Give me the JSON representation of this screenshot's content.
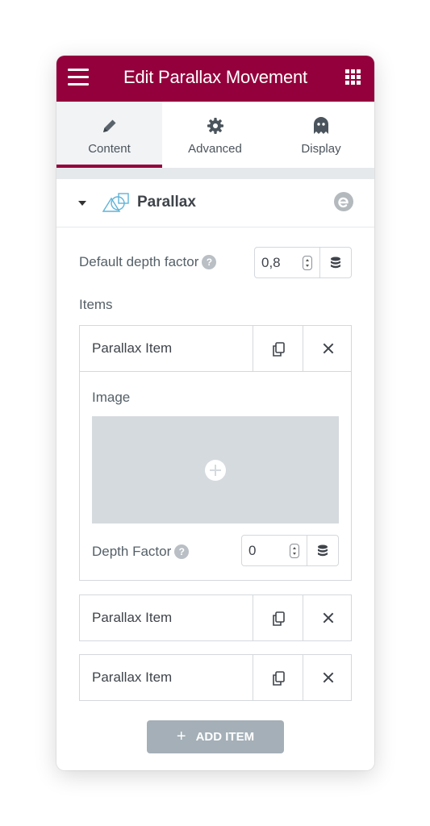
{
  "header": {
    "title": "Edit Parallax Movement"
  },
  "tabs": [
    {
      "label": "Content",
      "icon": "pencil-icon",
      "active": true
    },
    {
      "label": "Advanced",
      "icon": "gear-icon",
      "active": false
    },
    {
      "label": "Display",
      "icon": "ghost-icon",
      "active": false
    }
  ],
  "section": {
    "title": "Parallax",
    "icon": "parallax-shapes-icon",
    "badge_icon": "extension-logo-icon"
  },
  "default_depth": {
    "label": "Default depth factor",
    "value": "0,8"
  },
  "items_label": "Items",
  "items": [
    {
      "title": "Parallax Item",
      "expanded": true
    },
    {
      "title": "Parallax Item",
      "expanded": false
    },
    {
      "title": "Parallax Item",
      "expanded": false
    }
  ],
  "item_fields": {
    "image_label": "Image",
    "depth_label": "Depth Factor",
    "depth_value": "0"
  },
  "add_item": {
    "label": "ADD ITEM"
  },
  "colors": {
    "accent": "#93003c",
    "button": "#a4afb7",
    "placeholder": "#d5dadf"
  }
}
